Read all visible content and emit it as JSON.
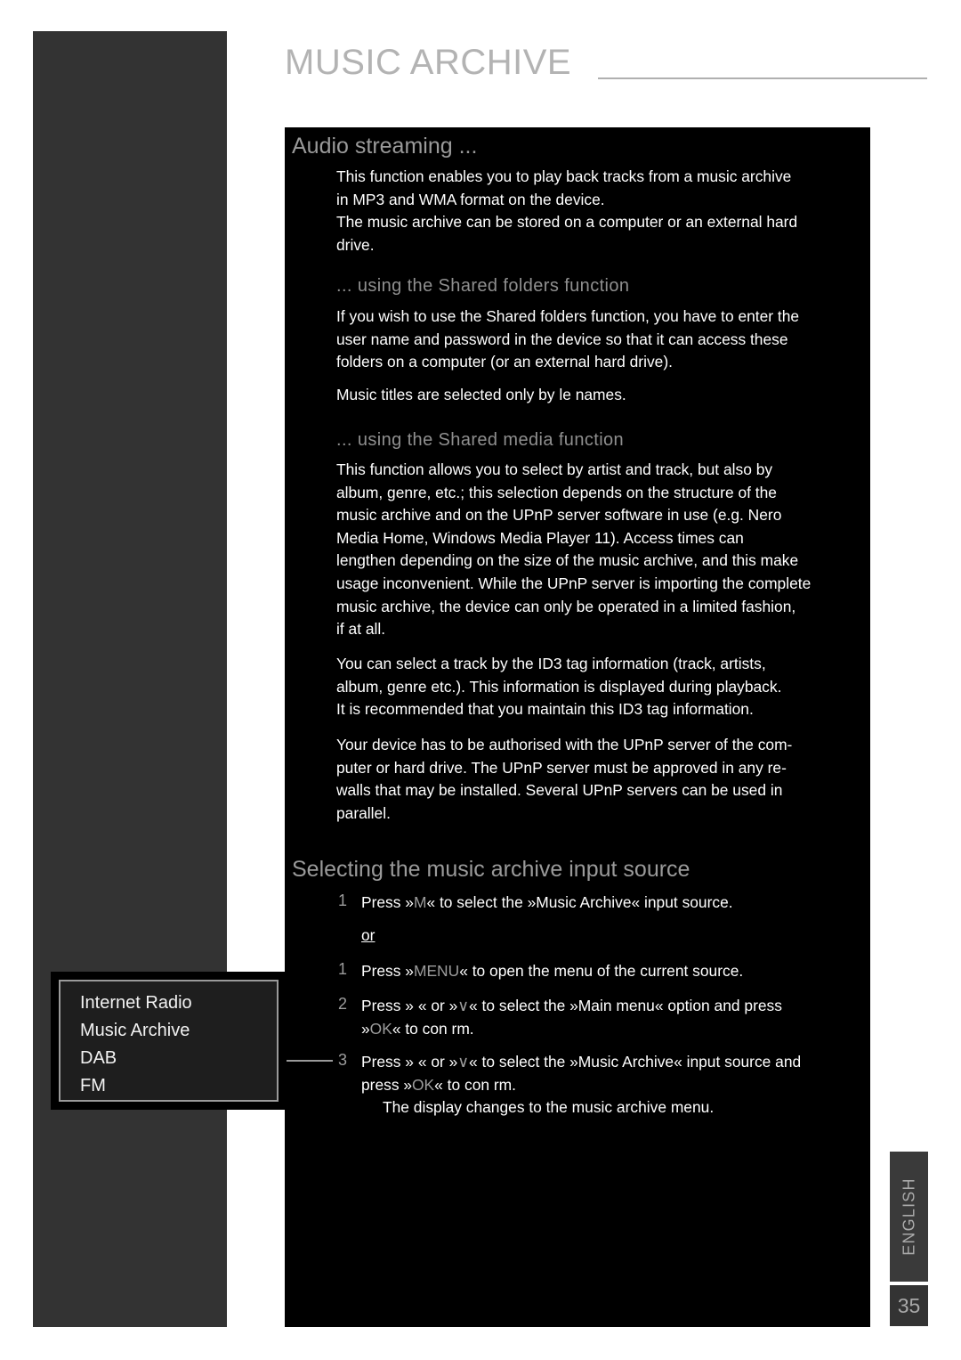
{
  "header": {
    "title": "MUSIC ARCHIVE"
  },
  "sections": {
    "audio_streaming": {
      "heading": "Audio streaming ...",
      "paragraphs": [
        "This function enables you to play back tracks from a music archive",
        "in MP3 and WMA format on the device.",
        "The music archive can be stored on a computer or an external hard",
        "drive."
      ]
    },
    "shared_folders": {
      "heading": "... using the  Shared folders  function",
      "paragraphs": [
        "If you wish to use the  Shared folders  function, you have to enter the",
        "user name and password in the device so  that it can access these",
        "folders on a computer (or an external hard drive)."
      ],
      "note": "Music titles are selected only by  le names."
    },
    "shared_media": {
      "heading": "... using the  Shared media  function",
      "paragraph1": [
        "This function allows you to select by artist and track, but also by",
        "album, genre, etc.; this selection depends on the structure of the",
        "music archive and on the UPnP server software in use (e.g. Nero",
        "Media  Home,  Windows  Media  Player  11).  Access  times  can",
        "lengthen depending on the size of the music archive, and this make",
        "usage inconvenient. While the UPnP server is importing the complete",
        "music archive, the device can only be operated in a limited fashion,",
        "if at all."
      ],
      "paragraph2": [
        "You can select a track by the ID3 tag information (track, artists,",
        "album, genre etc.). This information is displayed during playback.",
        "It is recommended that you maintain this ID3 tag information."
      ],
      "paragraph3": [
        "Your device has to be authorised with the UPnP server of the com-",
        "puter or hard drive. The UPnP server must be approved in any  re-",
        "walls that may be installed. Several UPnP servers can be used in",
        "parallel."
      ]
    },
    "selecting_source": {
      "heading": "Selecting the music archive input source",
      "or_label": "or",
      "steps": [
        {
          "number": "1",
          "lines": [
            [
              {
                "t": "Press »",
                "k": false
              },
              {
                "t": "M",
                "k": true
              },
              {
                "t": "« to select the »Music Archive« input source.",
                "k": false
              }
            ]
          ]
        },
        {
          "number": "1",
          "lines": [
            [
              {
                "t": "Press »",
                "k": false
              },
              {
                "t": "MENU",
                "k": true
              },
              {
                "t": "« to open the menu of the current source.",
                "k": false
              }
            ]
          ]
        },
        {
          "number": "2",
          "lines": [
            [
              {
                "t": "Press »",
                "k": false
              },
              {
                "t": "  ",
                "k": true
              },
              {
                "t": "« or »",
                "k": false
              },
              {
                "t": "∨",
                "k": true
              },
              {
                "t": "« to select the »Main menu« option and press",
                "k": false
              }
            ],
            [
              {
                "t": "»",
                "k": false
              },
              {
                "t": "OK",
                "k": true
              },
              {
                "t": "« to con rm.",
                "k": false
              }
            ]
          ]
        },
        {
          "number": "3",
          "lines": [
            [
              {
                "t": "Press »",
                "k": false
              },
              {
                "t": "  ",
                "k": true
              },
              {
                "t": "« or »",
                "k": false
              },
              {
                "t": "∨",
                "k": true
              },
              {
                "t": "« to select the »Music Archive« input source and",
                "k": false
              }
            ],
            [
              {
                "t": "press »",
                "k": false
              },
              {
                "t": "OK",
                "k": true
              },
              {
                "t": "« to con rm.",
                "k": false
              }
            ]
          ],
          "result": "The display changes to the music archive menu."
        }
      ]
    }
  },
  "callout_menu": {
    "items": [
      "Internet Radio",
      "Music Archive",
      "DAB",
      "FM"
    ]
  },
  "side_tab": {
    "language": "ENGLISH",
    "page_number": "35"
  },
  "colors": {
    "panel_bg": "#000000",
    "sidebar": "#333333",
    "heading_gray": "#9a9a9a",
    "body_white": "#ffffff",
    "keycap_gray": "#9c9c9c"
  }
}
